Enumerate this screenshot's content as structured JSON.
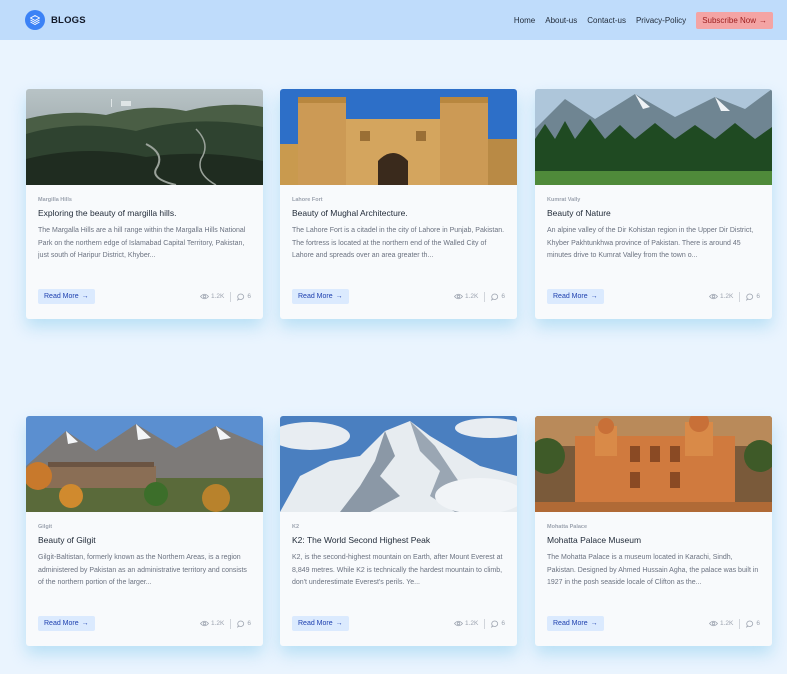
{
  "header": {
    "brand": "BLOGS",
    "nav": [
      "Home",
      "About-us",
      "Contact-us",
      "Privacy-Policy"
    ],
    "subscribe_label": "Subscribe Now",
    "subscribe_arrow": "→"
  },
  "cards": [
    {
      "tag": "Margilla Hills",
      "title": "Exploring the beauty of margilla hills.",
      "text": "The Margalla Hills are a hill range within the Margalla Hills National Park on the northern edge of Islamabad Capital Territory, Pakistan, just south of Haripur District, Khyber...",
      "read_more": "Read More",
      "arrow": "→",
      "views": "1.2K",
      "comments": "6",
      "image": "margalla-hills-photo"
    },
    {
      "tag": "Lahore Fort",
      "title": "Beauty of Mughal Architecture.",
      "text": "The Lahore Fort is a citadel in the city of Lahore in Punjab, Pakistan. The fortress is located at the northern end of the Walled City of Lahore and spreads over an area greater th...",
      "read_more": "Read More",
      "arrow": "→",
      "views": "1.2K",
      "comments": "6",
      "image": "lahore-fort-photo"
    },
    {
      "tag": "Kumrat Vally",
      "title": "Beauty of Nature",
      "text": "An alpine valley of the Dir Kohistan region in the Upper Dir District, Khyber Pakhtunkhwa province of Pakistan. There is around 45 minutes drive to Kumrat Valley from the town o...",
      "read_more": "Read More",
      "arrow": "→",
      "views": "1.2K",
      "comments": "6",
      "image": "kumrat-valley-photo"
    },
    {
      "tag": "Gilgit",
      "title": "Beauty of Gilgit",
      "text": "Gilgit-Baltistan, formerly known as the Northern Areas, is a region administered by Pakistan as an administrative territory and consists of the northern portion of the larger...",
      "read_more": "Read More",
      "arrow": "→",
      "views": "1.2K",
      "comments": "6",
      "image": "gilgit-photo"
    },
    {
      "tag": "K2",
      "title": "K2: The World Second Highest Peak",
      "text": "K2, is the second-highest mountain on Earth, after Mount Everest at 8,849 metres. While K2 is technically the hardest mountain to climb, don't underestimate Everest's perils. Ye...",
      "read_more": "Read More",
      "arrow": "→",
      "views": "1.2K",
      "comments": "6",
      "image": "k2-photo"
    },
    {
      "tag": "Mohatta Palace",
      "title": "Mohatta Palace Museum",
      "text": "The Mohatta Palace is a museum located in Karachi, Sindh, Pakistan. Designed by Ahmed Hussain Agha, the palace was built in 1927 in the posh seaside locale of Clifton as the...",
      "read_more": "Read More",
      "arrow": "→",
      "views": "1.2K",
      "comments": "6",
      "image": "mohatta-palace-photo"
    }
  ],
  "colors": {
    "navbar": "#bfdcfb",
    "page_bg": "#eaf4fe",
    "subscribe_bg": "#f4a4a4",
    "read_more_bg": "#dbeafe",
    "logo": "#3b82f6"
  }
}
